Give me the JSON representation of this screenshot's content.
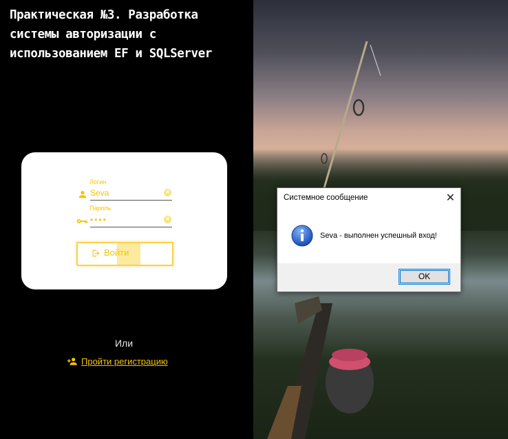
{
  "left_panel": {
    "title": "Практическая  №3. Разработка системы авторизации с использованием EF и SQLServer",
    "login": {
      "label": "Логин",
      "value": "Seva"
    },
    "password": {
      "label": "Пароль",
      "value": "••••"
    },
    "login_button": "Войти",
    "or_text": "Или",
    "register_link": "Пройти регистрацию"
  },
  "dialog": {
    "title": "Системное сообщение",
    "message": "Seva - выполнен успешный вход!",
    "ok_button": "OK"
  },
  "icons": [
    "person-icon",
    "key-icon",
    "clear-icon",
    "login-icon",
    "person-add-icon",
    "info-icon",
    "close-icon"
  ],
  "colors": {
    "accent": "#f6c400",
    "background": "#000000",
    "card": "#ffffff"
  }
}
